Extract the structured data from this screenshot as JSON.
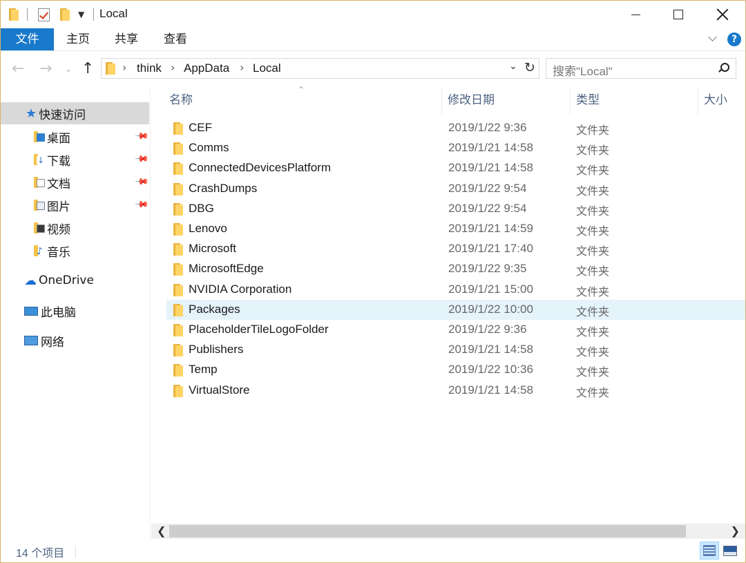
{
  "window": {
    "title": "Local",
    "controls": {
      "minimize": "minimize",
      "maximize": "maximize",
      "close": "close"
    }
  },
  "ribbon": {
    "tabs": [
      "文件",
      "主页",
      "共享",
      "查看"
    ],
    "help": "?"
  },
  "address": {
    "crumbs": [
      "think",
      "AppData",
      "Local"
    ],
    "search_placeholder": "搜索\"Local\""
  },
  "nav_pane": {
    "quick_access": "快速访问",
    "pinned": [
      {
        "label": "桌面",
        "icon": "desktop-icon",
        "pinned": true
      },
      {
        "label": "下载",
        "icon": "download-icon",
        "pinned": true
      },
      {
        "label": "文档",
        "icon": "documents-icon",
        "pinned": true
      },
      {
        "label": "图片",
        "icon": "pictures-icon",
        "pinned": true
      },
      {
        "label": "视频",
        "icon": "videos-icon",
        "pinned": false
      },
      {
        "label": "音乐",
        "icon": "music-icon",
        "pinned": false
      }
    ],
    "onedrive": "OneDrive",
    "this_pc": "此电脑",
    "network": "网络"
  },
  "columns": {
    "name": "名称",
    "date": "修改日期",
    "type": "类型",
    "size": "大小"
  },
  "files": [
    {
      "name": "CEF",
      "date": "2019/1/22 9:36",
      "type": "文件夹"
    },
    {
      "name": "Comms",
      "date": "2019/1/21 14:58",
      "type": "文件夹"
    },
    {
      "name": "ConnectedDevicesPlatform",
      "date": "2019/1/21 14:58",
      "type": "文件夹"
    },
    {
      "name": "CrashDumps",
      "date": "2019/1/22 9:54",
      "type": "文件夹"
    },
    {
      "name": "DBG",
      "date": "2019/1/22 9:54",
      "type": "文件夹"
    },
    {
      "name": "Lenovo",
      "date": "2019/1/21 14:59",
      "type": "文件夹"
    },
    {
      "name": "Microsoft",
      "date": "2019/1/21 17:40",
      "type": "文件夹"
    },
    {
      "name": "MicrosoftEdge",
      "date": "2019/1/22 9:35",
      "type": "文件夹"
    },
    {
      "name": "NVIDIA Corporation",
      "date": "2019/1/21 15:00",
      "type": "文件夹"
    },
    {
      "name": "Packages",
      "date": "2019/1/22 10:00",
      "type": "文件夹",
      "highlighted": true
    },
    {
      "name": "PlaceholderTileLogoFolder",
      "date": "2019/1/22 9:36",
      "type": "文件夹"
    },
    {
      "name": "Publishers",
      "date": "2019/1/21 14:58",
      "type": "文件夹"
    },
    {
      "name": "Temp",
      "date": "2019/1/22 10:36",
      "type": "文件夹"
    },
    {
      "name": "VirtualStore",
      "date": "2019/1/21 14:58",
      "type": "文件夹"
    }
  ],
  "status": {
    "item_count": "14 个项目"
  },
  "colors": {
    "accent": "#1979ca",
    "folder": "#ffd466",
    "selected_nav": "#d9d9d9",
    "row_hover": "#e5f3fb"
  }
}
